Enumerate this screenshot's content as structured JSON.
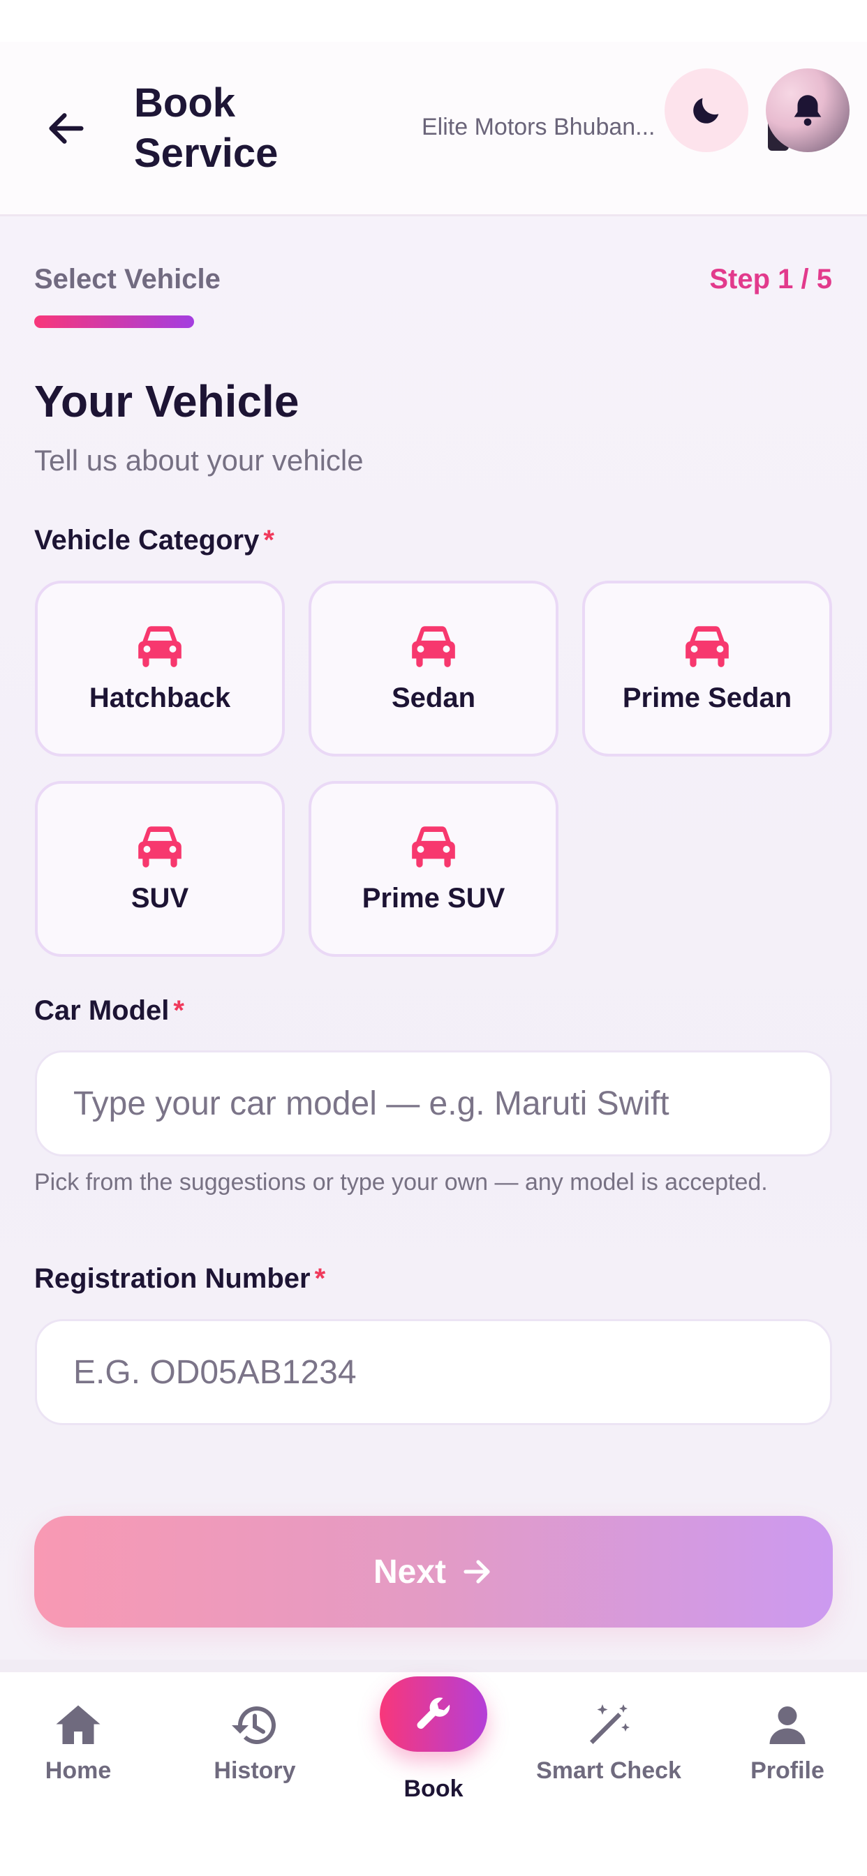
{
  "header": {
    "title": "Book Service",
    "garage_name": "Elite Motors Bhuban..."
  },
  "step": {
    "label": "Select Vehicle",
    "count": "Step 1 / 5",
    "progress": 0.2
  },
  "section": {
    "title": "Your Vehicle",
    "subtitle": "Tell us about your vehicle"
  },
  "vehicle_category": {
    "label": "Vehicle Category",
    "required_mark": "*",
    "options": [
      "Hatchback",
      "Sedan",
      "Prime Sedan",
      "SUV",
      "Prime SUV"
    ]
  },
  "car_model": {
    "label": "Car Model",
    "required_mark": "*",
    "value": "",
    "placeholder": "Type your car model — e.g. Maruti Swift",
    "hint": "Pick from the suggestions or type your own — any model is accepted."
  },
  "registration": {
    "label": "Registration Number",
    "required_mark": "*",
    "value": "",
    "placeholder": "E.G. OD05AB1234"
  },
  "next_button": {
    "label": "Next"
  },
  "bottom_nav": {
    "home": "Home",
    "history": "History",
    "book": "Book",
    "smart_check": "Smart Check",
    "profile": "Profile"
  },
  "icons": {
    "back": "arrow-left-icon",
    "theme": "moon-icon",
    "notifications": "bell-icon",
    "category": "car-icon",
    "next": "arrow-right-icon",
    "home": "home-icon",
    "history": "history-icon",
    "book": "wrench-icon",
    "smart_check": "magic-wand-icon",
    "profile": "user-icon"
  },
  "colors": {
    "accent_pink": "#f8377a",
    "accent_purple": "#a43ee0",
    "required": "#f0395b",
    "step_count": "#e23a8c",
    "text_dark": "#1d1434"
  }
}
